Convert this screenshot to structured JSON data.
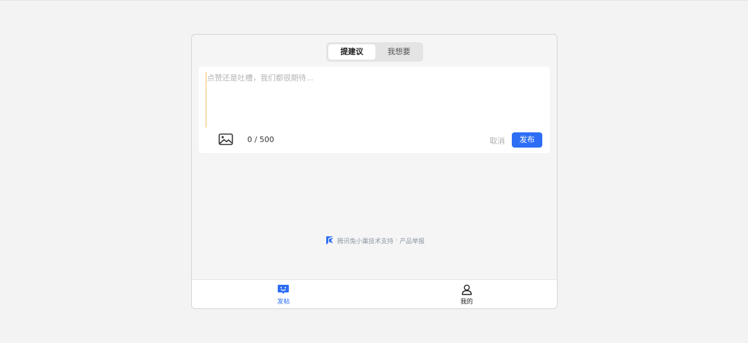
{
  "tabs": [
    {
      "label": "提建议",
      "active": true
    },
    {
      "label": "我想要",
      "active": false
    }
  ],
  "editor": {
    "placeholder": "点赞还是吐槽，我们都很期待...",
    "value": "",
    "counter": "0 / 500",
    "cancel_label": "取消",
    "publish_label": "发布"
  },
  "footer": {
    "support_text": "腾讯兔小巢技术支持",
    "separator": "·",
    "report_label": "产品举报"
  },
  "bottom_nav": [
    {
      "label": "发帖",
      "icon": "post-icon",
      "active": true
    },
    {
      "label": "我的",
      "icon": "user-icon",
      "active": false
    }
  ],
  "colors": {
    "accent": "#2e6ef5",
    "background": "#f5f5f5",
    "muted_text": "#b0b0b0"
  }
}
